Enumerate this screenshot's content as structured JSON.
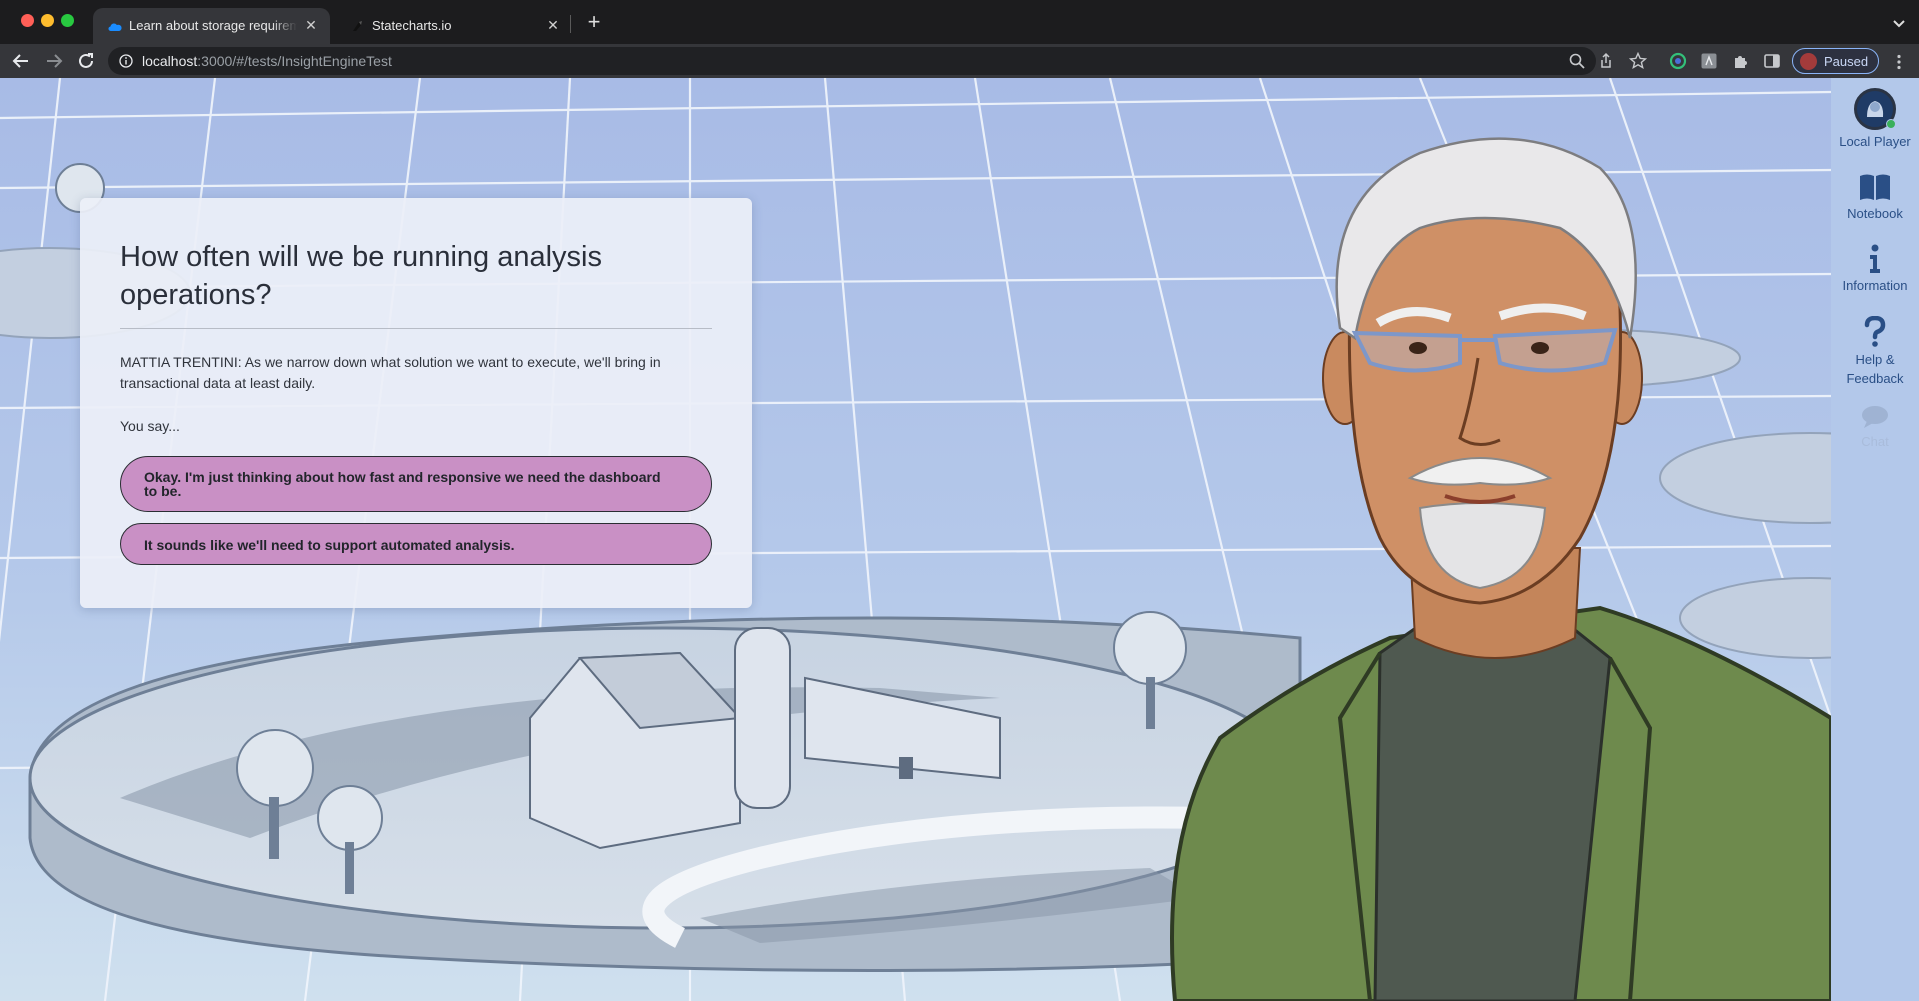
{
  "browser": {
    "tabs": [
      {
        "title": "Learn about storage requireme",
        "active": true
      },
      {
        "title": "Statecharts.io",
        "active": false
      }
    ],
    "close_glyph": "✕",
    "newtab_glyph": "+",
    "url_host": "localhost",
    "url_rest": ":3000/#/tests/InsightEngineTest",
    "profile_label": "Paused"
  },
  "dialog": {
    "title": "How often will we be running analysis operations?",
    "speech": "MATTIA TRENTINI: As we narrow down what solution we want to execute, we'll bring in transactional data at least daily.",
    "prompt": "You say...",
    "choices": [
      "Okay. I'm just thinking about how fast and responsive we need the dashboard to be.",
      "It sounds like we'll need to support automated analysis."
    ]
  },
  "sidepanel": {
    "player_label": "Local Player",
    "items": [
      {
        "label": "Notebook",
        "icon": "book-icon"
      },
      {
        "label": "Information",
        "icon": "info-icon"
      },
      {
        "label": "Help &\nFeedback",
        "icon": "question-icon"
      },
      {
        "label": "Chat",
        "icon": "chat-icon",
        "disabled": true
      }
    ]
  },
  "colors": {
    "choice_fill": "#c990c5",
    "panel_bg": "#b3c8ea",
    "panel_text": "#2a4f86",
    "jacket": "#6e8a4d",
    "sky": "#a9bde6"
  }
}
